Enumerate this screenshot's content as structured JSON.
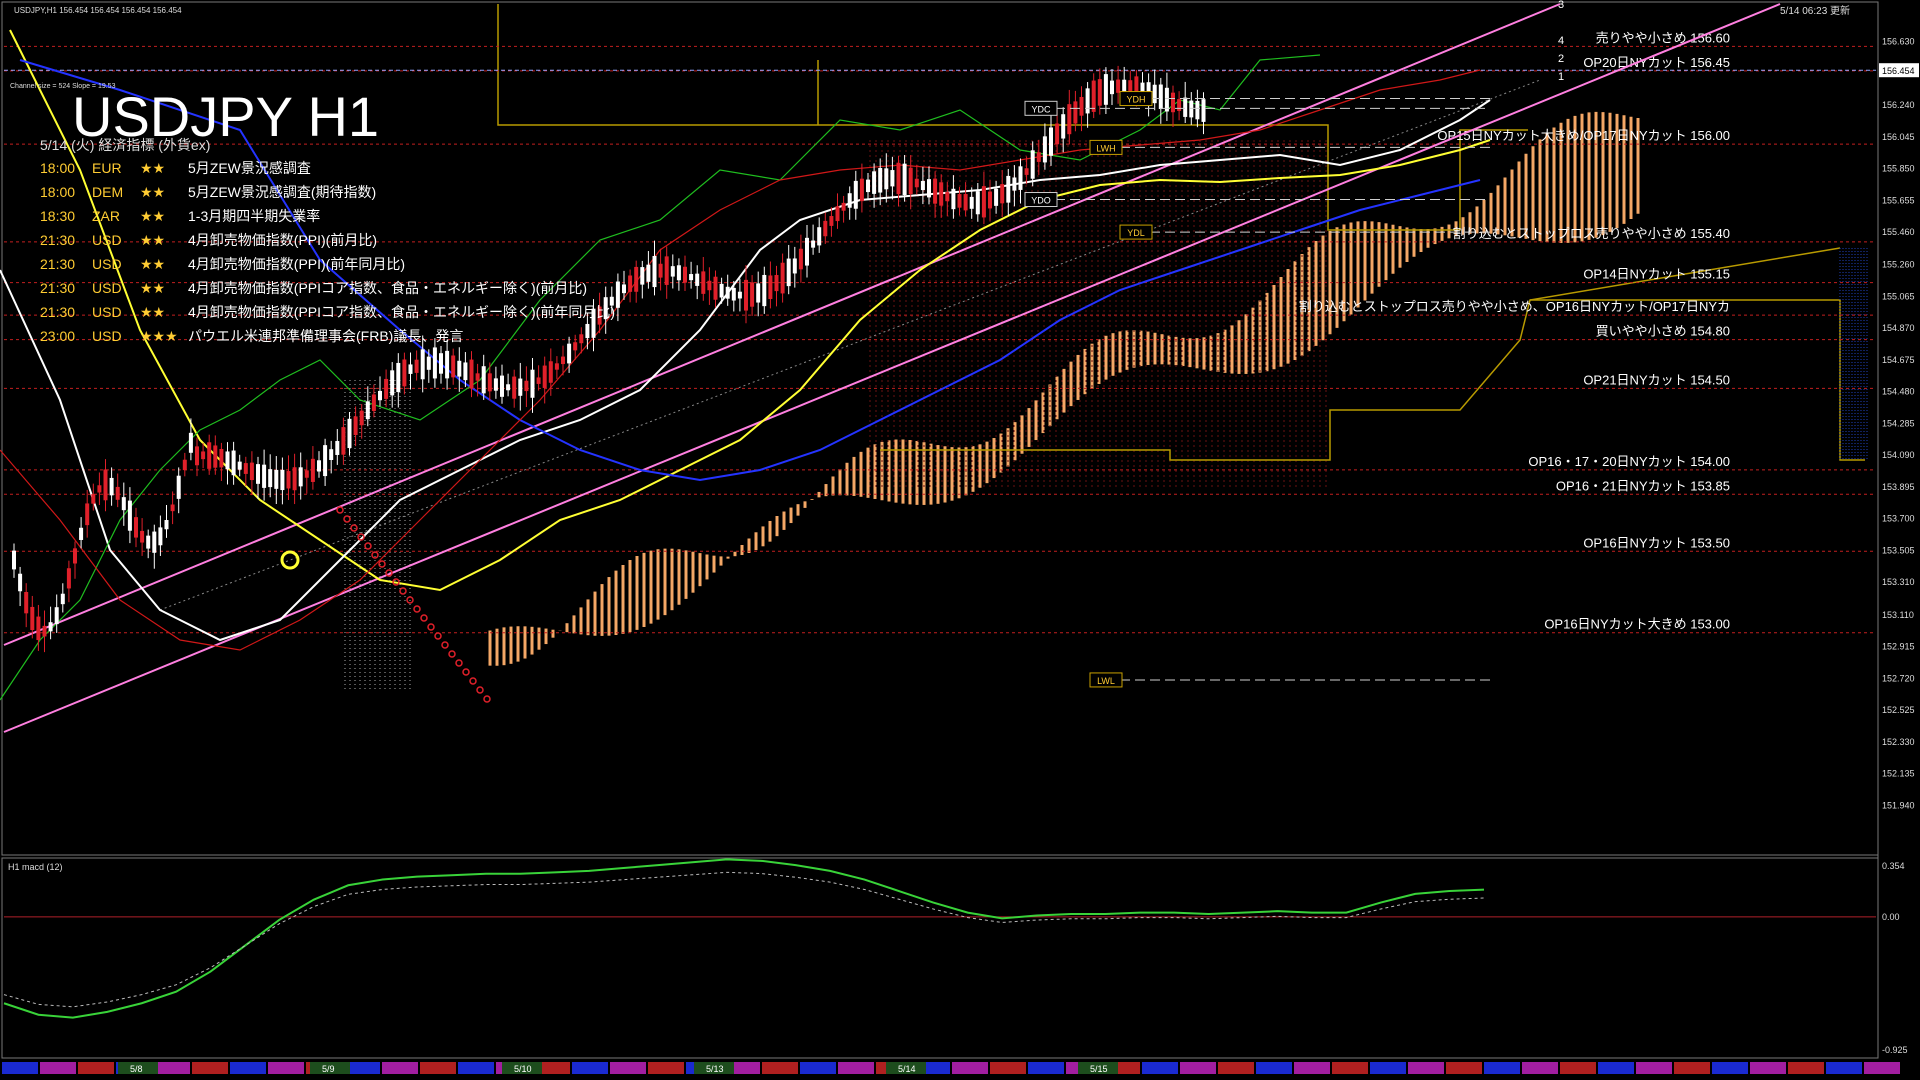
{
  "header": {
    "symbol_line": "USDJPY,H1  156.454 156.454 156.454 156.454",
    "updated": "5/14 06:23 更新",
    "channel_info": "Channel size = 524 Slope = 19.53"
  },
  "title": "USDJPY H1",
  "events": {
    "heading": "5/14 (火) 経済指標 (外貨ex)",
    "rows": [
      {
        "time": "18:00",
        "cur": "EUR",
        "stars": "★★",
        "name": "5月ZEW景況感調査",
        "color": "#ffcc33"
      },
      {
        "time": "18:00",
        "cur": "DEM",
        "stars": "★★",
        "name": "5月ZEW景況感調査(期待指数)",
        "color": "#ffcc33"
      },
      {
        "time": "18:30",
        "cur": "ZAR",
        "stars": "★★",
        "name": "1-3月期四半期失業率",
        "color": "#ffcc33"
      },
      {
        "time": "21:30",
        "cur": "USD",
        "stars": "★★",
        "name": "4月卸売物価指数(PPI)(前月比)",
        "color": "#ffcc33"
      },
      {
        "time": "21:30",
        "cur": "USD",
        "stars": "★★",
        "name": "4月卸売物価指数(PPI)(前年同月比)",
        "color": "#ffcc33"
      },
      {
        "time": "21:30",
        "cur": "USD",
        "stars": "★★",
        "name": "4月卸売物価指数(PPIコア指数、食品・エネルギー除く)(前月比)",
        "color": "#ffcc33"
      },
      {
        "time": "21:30",
        "cur": "USD",
        "stars": "★★",
        "name": "4月卸売物価指数(PPIコア指数、食品・エネルギー除く)(前年同月比)",
        "color": "#ffcc33"
      },
      {
        "time": "23:00",
        "cur": "USD",
        "stars": "★★★",
        "name": "パウエル米連邦準備理事会(FRB)議長、発言",
        "color": "#ffcc33"
      }
    ]
  },
  "price_axis": {
    "ticks": [
      "156.630",
      "156.240",
      "156.045",
      "155.850",
      "155.655",
      "155.460",
      "155.260",
      "155.065",
      "154.870",
      "154.675",
      "154.480",
      "154.285",
      "154.090",
      "153.895",
      "153.700",
      "153.505",
      "153.310",
      "153.110",
      "152.915",
      "152.720",
      "152.525",
      "152.330",
      "152.135",
      "151.940"
    ],
    "current_price": "156.454"
  },
  "chart_data": {
    "type": "candlestick",
    "symbol": "USDJPY",
    "timeframe": "H1",
    "ylim": [
      151.85,
      156.75
    ],
    "current_price": 156.454,
    "date_labels": [
      "5/8",
      "5/9",
      "5/10",
      "5/13",
      "5/14",
      "5/15"
    ],
    "levels": [
      {
        "price": 156.6,
        "label": "売りやや小さめ 156.60"
      },
      {
        "price": 156.45,
        "label": "OP20日NYカット 156.45"
      },
      {
        "price": 156.0,
        "label": "OP15日NYカット大きめ/OP17日NYカット 156.00"
      },
      {
        "price": 155.4,
        "label": "割り込むとストップロス売りやや小さめ 155.40"
      },
      {
        "price": 155.15,
        "label": "OP14日NYカット 155.15"
      },
      {
        "price": 154.95,
        "label": "割り込むとストップロス売りやや小さめ、OP16日NYカット/OP17日NYカ"
      },
      {
        "price": 154.8,
        "label": "買いやや小さめ 154.80"
      },
      {
        "price": 154.5,
        "label": "OP21日NYカット 154.50"
      },
      {
        "price": 154.0,
        "label": "OP16・17・20日NYカット 154.00"
      },
      {
        "price": 153.85,
        "label": "OP16・21日NYカット 153.85"
      },
      {
        "price": 153.5,
        "label": "OP16日NYカット 153.50"
      },
      {
        "price": 153.0,
        "label": "OP16日NYカット大きめ 153.00"
      }
    ],
    "markers": [
      {
        "name": "YDH",
        "price": 156.28
      },
      {
        "name": "YDC",
        "price": 156.22
      },
      {
        "name": "LWH",
        "price": 155.98
      },
      {
        "name": "YDO",
        "price": 155.66
      },
      {
        "name": "YDL",
        "price": 155.46
      },
      {
        "name": "LWL",
        "price": 152.71
      }
    ],
    "fib_labels": [
      "3",
      "4",
      "2",
      "1"
    ],
    "macd": {
      "label": "H1 macd (12)",
      "ticks": [
        "0.354",
        "0.00",
        "-0.925"
      ],
      "values": [
        -0.6,
        -0.68,
        -0.7,
        -0.66,
        -0.6,
        -0.52,
        -0.38,
        -0.2,
        -0.02,
        0.12,
        0.22,
        0.26,
        0.28,
        0.29,
        0.3,
        0.3,
        0.31,
        0.32,
        0.34,
        0.36,
        0.38,
        0.4,
        0.39,
        0.36,
        0.32,
        0.26,
        0.18,
        0.1,
        0.03,
        -0.01,
        0.01,
        0.02,
        0.02,
        0.03,
        0.03,
        0.02,
        0.03,
        0.04,
        0.03,
        0.03,
        0.1,
        0.16,
        0.18,
        0.19
      ]
    }
  }
}
